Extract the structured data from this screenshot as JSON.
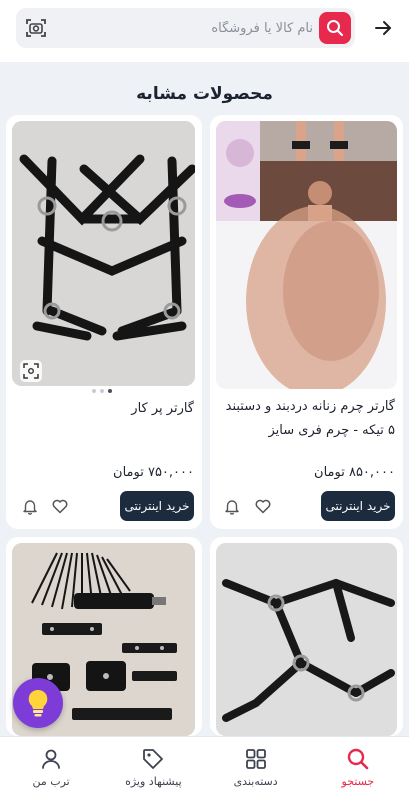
{
  "search": {
    "placeholder": "نام کالا یا فروشگاه"
  },
  "section": {
    "title": "محصولات مشابه"
  },
  "products": [
    {
      "title": "گارتر چرم زنانه دردبند و دستبند ۵ تیکه - چرم فری سایز",
      "price": "۸۵۰,۰۰۰ تومان",
      "buy_label": "خرید اینترنتی"
    },
    {
      "title": "گارتر پر کار",
      "price": "۷۵۰,۰۰۰ تومان",
      "buy_label": "خرید اینترنتی",
      "image_dots": 3,
      "active_dot": 2
    },
    {
      "title": "",
      "price": ""
    },
    {
      "title": "",
      "price": ""
    }
  ],
  "nav": [
    {
      "label": "جستجو",
      "icon": "search-icon",
      "active": true
    },
    {
      "label": "دسته‌بندی",
      "icon": "grid-icon",
      "active": false
    },
    {
      "label": "پیشنهاد ویژه",
      "icon": "tag-icon",
      "active": false
    },
    {
      "label": "ترب من",
      "icon": "user-icon",
      "active": false
    }
  ],
  "colors": {
    "accent": "#e6294d",
    "button_dark": "#1c2b3e",
    "lamp": "#7d3bd8",
    "background": "#eef1f6"
  }
}
